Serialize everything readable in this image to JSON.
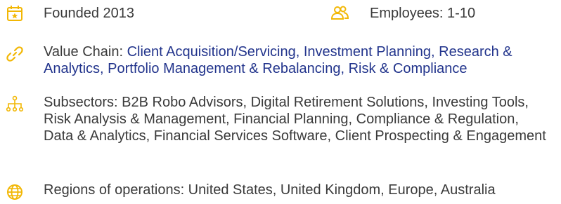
{
  "colors": {
    "accent": "#f2b705",
    "link": "#22348c",
    "text": "#3a3a3a"
  },
  "icons": {
    "founded": "calendar-star-icon",
    "employees": "people-icon",
    "value_chain": "link-icon",
    "subsectors": "hierarchy-icon",
    "regions": "globe-icon"
  },
  "founded": {
    "text": "Founded 2013"
  },
  "employees": {
    "text": "Employees: 1-10"
  },
  "value_chain": {
    "label": "Value Chain: ",
    "value": "Client Acquisition/Servicing, Investment Planning, Research & Analytics, Portfolio Management & Rebalancing, Risk & Compliance"
  },
  "subsectors": {
    "text": "Subsectors: B2B Robo Advisors, Digital Retirement Solutions, Investing Tools, Risk Analysis & Management, Financial Planning, Compliance & Regulation, Data & Analytics, Financial Services Software, Client Prospecting & Engagement"
  },
  "regions": {
    "text": "Regions of operations: United States, United Kingdom, Europe, Australia"
  }
}
